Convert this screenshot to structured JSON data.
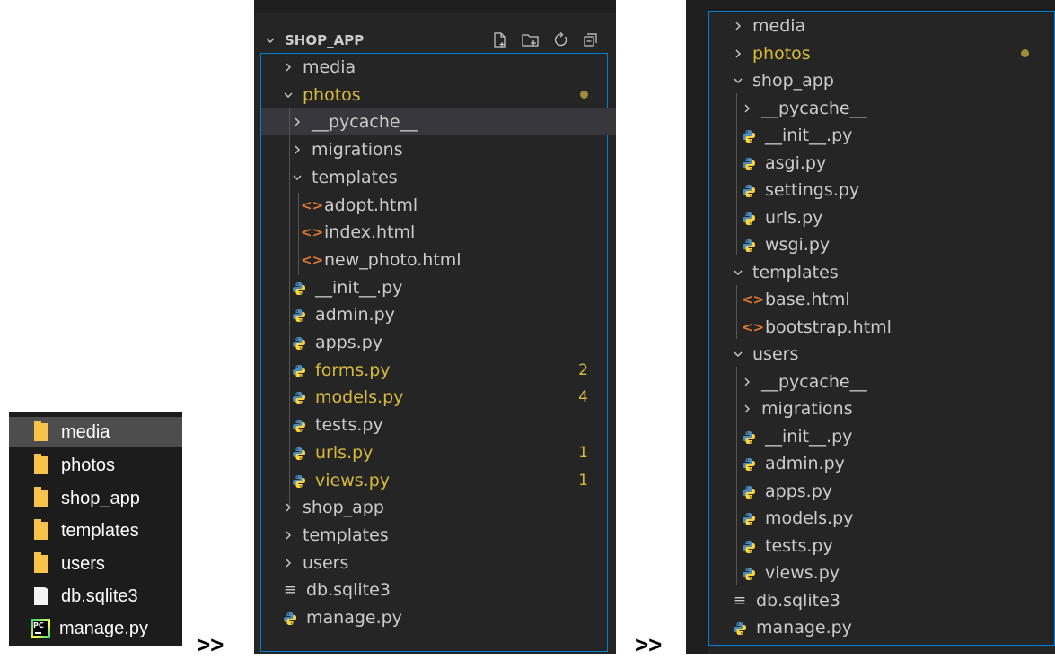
{
  "explorer": {
    "items": [
      {
        "label": "media",
        "type": "folder"
      },
      {
        "label": "photos",
        "type": "folder"
      },
      {
        "label": "shop_app",
        "type": "folder"
      },
      {
        "label": "templates",
        "type": "folder"
      },
      {
        "label": "users",
        "type": "folder"
      },
      {
        "label": "db.sqlite3",
        "type": "file"
      },
      {
        "label": "manage.py",
        "type": "pycharm"
      }
    ]
  },
  "arrows": [
    ">>",
    ">>"
  ],
  "vscode_left": {
    "header": "SHOP_APP",
    "toolbar_icons": [
      "new-file-icon",
      "new-folder-icon",
      "refresh-icon",
      "collapse-all-icon"
    ],
    "items": [
      {
        "label": "media",
        "chevron": "right"
      },
      {
        "label": "photos",
        "chevron": "down",
        "modified_dot": true
      },
      {
        "label": "__pycache__",
        "chevron": "right"
      },
      {
        "label": "migrations",
        "chevron": "right"
      },
      {
        "label": "templates",
        "chevron": "down"
      },
      {
        "label": "adopt.html"
      },
      {
        "label": "index.html"
      },
      {
        "label": "new_photo.html"
      },
      {
        "label": "__init__.py"
      },
      {
        "label": "admin.py"
      },
      {
        "label": "apps.py"
      },
      {
        "label": "forms.py",
        "badge": "2"
      },
      {
        "label": "models.py",
        "badge": "4"
      },
      {
        "label": "tests.py"
      },
      {
        "label": "urls.py",
        "badge": "1"
      },
      {
        "label": "views.py",
        "badge": "1"
      },
      {
        "label": "shop_app",
        "chevron": "right"
      },
      {
        "label": "templates",
        "chevron": "right"
      },
      {
        "label": "users",
        "chevron": "right"
      },
      {
        "label": "db.sqlite3"
      },
      {
        "label": "manage.py"
      }
    ]
  },
  "vscode_right": {
    "items": [
      {
        "label": "media",
        "chevron": "right"
      },
      {
        "label": "photos",
        "chevron": "right",
        "modified_dot": true
      },
      {
        "label": "shop_app",
        "chevron": "down"
      },
      {
        "label": "__pycache__",
        "chevron": "right"
      },
      {
        "label": "__init__.py"
      },
      {
        "label": "asgi.py"
      },
      {
        "label": "settings.py"
      },
      {
        "label": "urls.py"
      },
      {
        "label": "wsgi.py"
      },
      {
        "label": "templates",
        "chevron": "down"
      },
      {
        "label": "base.html"
      },
      {
        "label": "bootstrap.html"
      },
      {
        "label": "users",
        "chevron": "down"
      },
      {
        "label": "__pycache__",
        "chevron": "right"
      },
      {
        "label": "migrations",
        "chevron": "right"
      },
      {
        "label": "__init__.py"
      },
      {
        "label": "admin.py"
      },
      {
        "label": "apps.py"
      },
      {
        "label": "models.py"
      },
      {
        "label": "tests.py"
      },
      {
        "label": "views.py"
      },
      {
        "label": "db.sqlite3"
      },
      {
        "label": "manage.py"
      }
    ]
  },
  "colors": {
    "panel_bg": "#252526",
    "text": "#cccccc",
    "modified": "#d7ba3c",
    "focus_border": "#007fd4",
    "html_icon": "#e37933",
    "python_blue": "#4b8bbe",
    "python_yellow": "#ffd43b"
  }
}
